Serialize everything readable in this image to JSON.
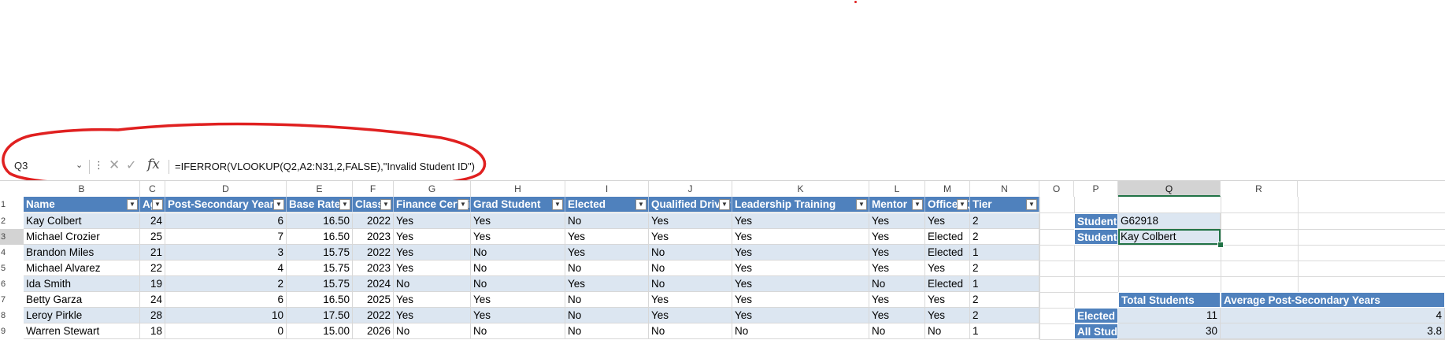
{
  "formula_bar": {
    "name_box": "Q3",
    "formula": "=IFERROR(VLOOKUP(Q2,A2:N31,2,FALSE),\"Invalid Student ID\")",
    "fx_label": "fx"
  },
  "columns": [
    "B",
    "C",
    "D",
    "E",
    "F",
    "G",
    "H",
    "I",
    "J",
    "K",
    "L",
    "M",
    "N",
    "O",
    "P",
    "Q",
    "R"
  ],
  "row_numbers": [
    "1",
    "2",
    "3",
    "4",
    "5",
    "6",
    "7",
    "8",
    "9"
  ],
  "table": {
    "headers": [
      "Name",
      "Age",
      "Post-Secondary Years",
      "Base Rate",
      "Class",
      "Finance Certified",
      "Grad Student",
      "Elected",
      "Qualified Driver",
      "Leadership Training",
      "Mentor",
      "Officer Qualified",
      "Tier"
    ],
    "rows": [
      [
        "Kay Colbert",
        "24",
        "6",
        "16.50",
        "2022",
        "Yes",
        "Yes",
        "No",
        "Yes",
        "Yes",
        "Yes",
        "Yes",
        "2"
      ],
      [
        "Michael Crozier",
        "25",
        "7",
        "16.50",
        "2023",
        "Yes",
        "Yes",
        "Yes",
        "Yes",
        "Yes",
        "Yes",
        "Elected",
        "2"
      ],
      [
        "Brandon Miles",
        "21",
        "3",
        "15.75",
        "2022",
        "Yes",
        "No",
        "Yes",
        "No",
        "Yes",
        "Yes",
        "Elected",
        "1"
      ],
      [
        "Michael Alvarez",
        "22",
        "4",
        "15.75",
        "2023",
        "Yes",
        "No",
        "No",
        "No",
        "Yes",
        "Yes",
        "Yes",
        "2"
      ],
      [
        "Ida Smith",
        "19",
        "2",
        "15.75",
        "2024",
        "No",
        "No",
        "Yes",
        "No",
        "Yes",
        "No",
        "Elected",
        "1"
      ],
      [
        "Betty Garza",
        "24",
        "6",
        "16.50",
        "2025",
        "Yes",
        "Yes",
        "No",
        "Yes",
        "Yes",
        "Yes",
        "Yes",
        "2"
      ],
      [
        "Leroy Pirkle",
        "28",
        "10",
        "17.50",
        "2022",
        "Yes",
        "Yes",
        "No",
        "Yes",
        "Yes",
        "Yes",
        "Yes",
        "2"
      ],
      [
        "Warren Stewart",
        "18",
        "0",
        "15.00",
        "2026",
        "No",
        "No",
        "No",
        "No",
        "No",
        "No",
        "No",
        "1"
      ]
    ]
  },
  "lookup": {
    "student_id_label": "Student ID",
    "student_id_value": "G62918",
    "student_name_label": "Student Name",
    "student_name_value": "Kay Colbert"
  },
  "summary": {
    "col_total": "Total Students",
    "col_avg": "Average Post-Secondary Years",
    "rows": [
      {
        "label": "Elected Students",
        "total": "11",
        "avg": "4"
      },
      {
        "label": "All Students",
        "total": "30",
        "avg": "3.8"
      }
    ]
  },
  "colors": {
    "header_blue": "#4f81bd",
    "band_blue": "#dce6f1",
    "selection_green": "#217346",
    "annotation_red": "#e02020"
  }
}
